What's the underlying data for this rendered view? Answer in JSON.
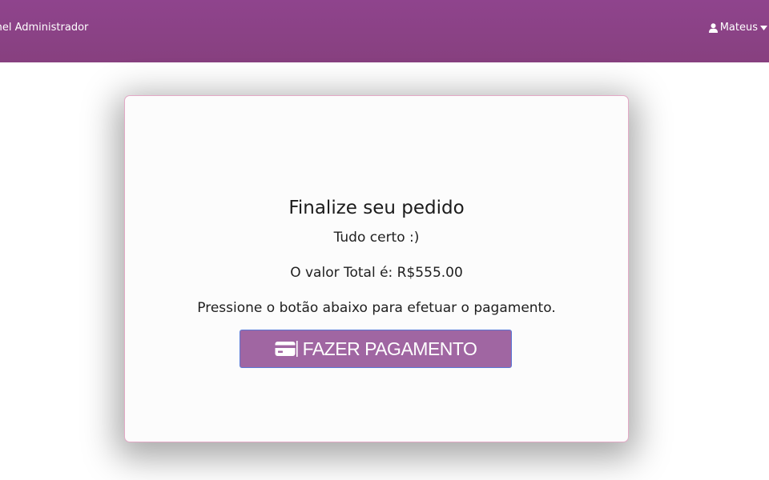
{
  "header": {
    "brand": "inel Administrador",
    "user_name": "Mateus",
    "user_icon": "user-icon",
    "caret_icon": "caret-down-icon",
    "background_color": "#8c438a"
  },
  "checkout": {
    "title": "Finalize seu pedido",
    "status": "Tudo certo :)",
    "total_text": "O valor Total é: R$555.00",
    "instruction": "Pressione o botão abaixo para efetuar o pagamento.",
    "pay_button": {
      "label": "FAZER PAGAMENTO",
      "icon": "credit-card-icon",
      "color": "#a066a2"
    }
  }
}
